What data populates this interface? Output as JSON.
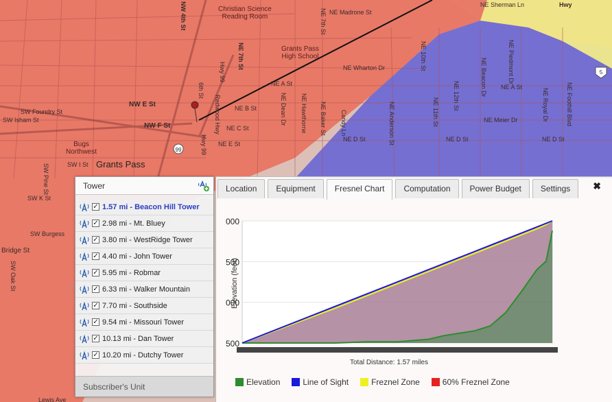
{
  "map": {
    "labels": {
      "christian_science": "Christian Science\nReading Room",
      "grants_pass_high": "Grants Pass\nHigh School",
      "bugs_northwest": "Bugs\nNorthwest",
      "grants_pass": "Grants Pass",
      "ne_madrone": "NE Madrone St",
      "ne_sherman": "NE Sherman Ln",
      "ne_wharton": "NE Wharton Dr",
      "ne_a": "NE A St",
      "ne_b": "NE B St",
      "ne_c": "NE C St",
      "ne_d": "NE D St",
      "ne_e": "NE E St",
      "ne_meier": "NE Meier Dr",
      "nw_e": "NW E St",
      "nw_f": "NW F St",
      "sw_foundry": "SW Foundry St",
      "sw_isham": "SW Isham St",
      "sw_i": "SW I St",
      "sw_k": "SW K St",
      "sw_oak": "SW Oak St",
      "sw_pine": "SW Pine St",
      "sw_burgess": "SW Burgess",
      "bridge": "Bridge St",
      "lewis_ave": "Lewis Ave",
      "hwy99": "Hwy 99",
      "redwood_hwy": "Redwood Hwy",
      "nw_4th": "NW 4th St",
      "ne_7th": "NE 7th St",
      "sixth": "6th St",
      "ne_dean": "NE Dean Dr",
      "ne_hawthorne": "NE Hawthorne",
      "ne_baker": "NE Baker St",
      "candy_ln": "Candy Ln",
      "ne_anderson": "NE Anderson St",
      "ne_10th": "NE 10th St",
      "ne_11th": "NE 11th St",
      "ne_12th": "NE 12th St",
      "ne_beacon": "NE Beacon Dr",
      "ne_piedmont": "NE Piedmont Dr",
      "ne_royal": "NE Royal Dr",
      "ne_foothill": "NE Foothill Blvd",
      "hwy_right": "Hwy",
      "shield_99": "99",
      "shield_5": "5"
    }
  },
  "tower_panel": {
    "title": "Tower",
    "towers": [
      {
        "label": "1.57 mi - Beacon Hill Tower",
        "checked": true,
        "selected": true
      },
      {
        "label": "2.98 mi - Mt. Bluey",
        "checked": true,
        "selected": false
      },
      {
        "label": "3.80 mi - WestRidge Tower",
        "checked": true,
        "selected": false
      },
      {
        "label": "4.40 mi - John Tower",
        "checked": true,
        "selected": false
      },
      {
        "label": "5.95 mi - Robmar",
        "checked": true,
        "selected": false
      },
      {
        "label": "6.33 mi - Walker Mountain",
        "checked": true,
        "selected": false
      },
      {
        "label": "7.70 mi - Southside",
        "checked": true,
        "selected": false
      },
      {
        "label": "9.54 mi - Missouri Tower",
        "checked": true,
        "selected": false
      },
      {
        "label": "10.13 mi - Dan Tower",
        "checked": true,
        "selected": false
      },
      {
        "label": "10.20 mi - Dutchy Tower",
        "checked": true,
        "selected": false
      }
    ],
    "subscriber_unit": "Subscriber's Unit"
  },
  "tabs": [
    "Location",
    "Equipment",
    "Fresnel Chart",
    "Computation",
    "Power Budget",
    "Settings"
  ],
  "active_tab": "Fresnel Chart",
  "close_label": "✖",
  "chart_data": {
    "type": "area",
    "ylabel": "Elevation (feet)",
    "y_tick_labels": [
      "000",
      "500",
      "000",
      "500"
    ],
    "x_label": "Total Distance: 1.57 miles",
    "x_fraction": [
      0,
      0.1,
      0.2,
      0.3,
      0.4,
      0.5,
      0.6,
      0.65,
      0.7,
      0.75,
      0.8,
      0.85,
      0.9,
      0.95,
      0.98,
      1.0
    ],
    "series": [
      {
        "name": "Elevation",
        "color": "#2e8b2e",
        "values": [
          0.0,
          0.0,
          0.0,
          0.0,
          0.01,
          0.01,
          0.03,
          0.06,
          0.08,
          0.1,
          0.14,
          0.25,
          0.42,
          0.6,
          0.67,
          0.92
        ]
      },
      {
        "name": "Line of Sight",
        "color": "#1a1adb",
        "values": [
          0.0,
          0.1,
          0.2,
          0.3,
          0.4,
          0.5,
          0.6,
          0.65,
          0.7,
          0.75,
          0.8,
          0.85,
          0.9,
          0.95,
          0.98,
          1.0
        ]
      },
      {
        "name": "Freznel Zone",
        "color": "#f0f020",
        "values": [
          0.0,
          0.095,
          0.19,
          0.285,
          0.385,
          0.485,
          0.585,
          0.635,
          0.685,
          0.735,
          0.785,
          0.835,
          0.885,
          0.935,
          0.97,
          1.0
        ]
      },
      {
        "name": "60% Freznel Zone",
        "color": "#e82020",
        "values": []
      }
    ],
    "ylim": [
      0,
      1
    ]
  }
}
